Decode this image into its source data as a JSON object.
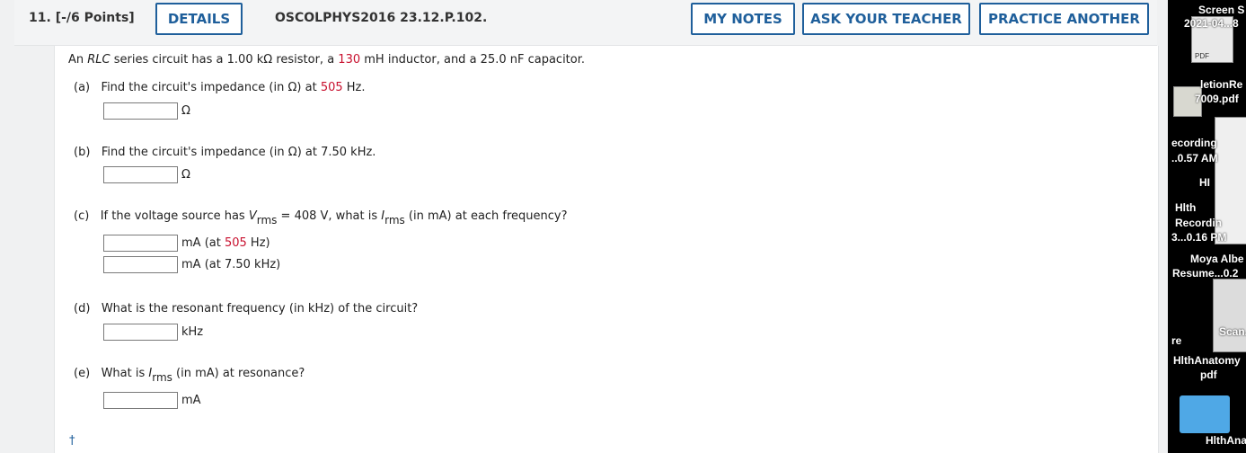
{
  "question": {
    "number": "11.",
    "points": "[-/6 Points]",
    "details_label": "DETAILS",
    "code": "OSCOLPHYS2016 23.12.P.102.",
    "my_notes_label": "MY NOTES",
    "ask_teacher_label": "ASK YOUR TEACHER",
    "practice_label": "PRACTICE ANOTHER"
  },
  "problem": {
    "intro_a": "An ",
    "intro_rlc": "RLC",
    "intro_b": " series circuit has a 1.00 kΩ resistor, a ",
    "intro_inductance": "130",
    "intro_c": " mH inductor, and a 25.0 nF capacitor.",
    "part_a": {
      "label": "(a)",
      "text_a": "Find the circuit's impedance (in Ω) at ",
      "freq": "505",
      "text_b": " Hz.",
      "unit": "Ω"
    },
    "part_b": {
      "label": "(b)",
      "text": "Find the circuit's impedance (in Ω) at 7.50 kHz.",
      "unit": "Ω"
    },
    "part_c": {
      "label": "(c)",
      "text_a": "If the voltage source has ",
      "v_symbol": "V",
      "v_sub": "rms",
      "text_b": " = 408 V, what is ",
      "i_symbol": "I",
      "i_sub": "rms",
      "text_c": " (in mA) at each frequency?",
      "row1_unit_a": "mA (at ",
      "row1_freq": "505",
      "row1_unit_b": " Hz)",
      "row2_unit": "mA (at 7.50 kHz)"
    },
    "part_d": {
      "label": "(d)",
      "text": "What is the resonant frequency (in kHz) of the circuit?",
      "unit": "kHz"
    },
    "part_e": {
      "label": "(e)",
      "text_a": "What is ",
      "i_symbol": "I",
      "i_sub": "rms",
      "text_b": " (in mA) at resonance?",
      "unit": "mA"
    },
    "footnote": "†"
  },
  "desktop": {
    "items": [
      {
        "label": "Screen S"
      },
      {
        "label": "2021-04...8"
      },
      {
        "label": "PDF"
      },
      {
        "label": "letionRe"
      },
      {
        "label": "7009.pdf"
      },
      {
        "label": "ecording"
      },
      {
        "label": "..0.57 AM"
      },
      {
        "label": "HI"
      },
      {
        "label": "Hlth"
      },
      {
        "label": "Recordin"
      },
      {
        "label": "3...0.16 PM"
      },
      {
        "label": "Moya Albe"
      },
      {
        "label": "Resume...0.2"
      },
      {
        "label": "Scan.jp"
      },
      {
        "label": "re"
      },
      {
        "label": "HlthAnatomy"
      },
      {
        "label": "pdf"
      },
      {
        "label": "HlthAna"
      }
    ]
  },
  "colors": {
    "accent": "#1f5f9b",
    "highlight": "#c8102e"
  }
}
